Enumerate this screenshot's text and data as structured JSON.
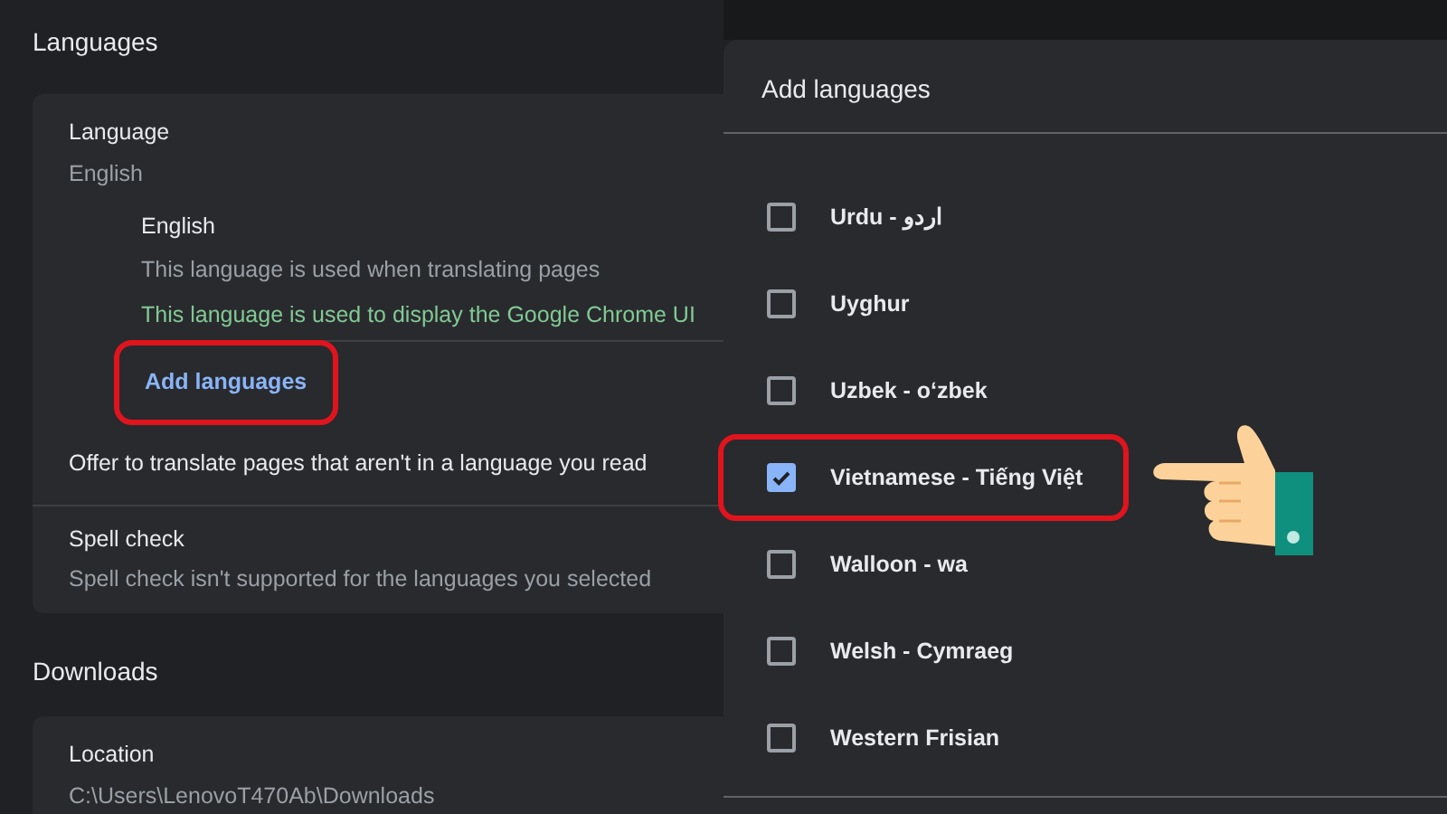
{
  "settings": {
    "languages_section": {
      "heading": "Languages",
      "language": {
        "label": "Language",
        "value": "English"
      },
      "language_item": {
        "name": "English",
        "notes": [
          {
            "kind": "plain",
            "text": "This language is used when translating pages"
          },
          {
            "kind": "ui",
            "text": "This language is used to display the Google Chrome UI"
          }
        ]
      },
      "add_button": {
        "label": "Add languages",
        "highlighted": true
      },
      "rows": [
        {
          "title": "Offer to translate pages that aren't in a language you read"
        },
        {
          "title": "Spell check",
          "subtitle": "Spell check isn't supported for the languages you selected"
        }
      ]
    },
    "downloads_section": {
      "heading": "Downloads",
      "location": {
        "label": "Location",
        "value": "C:\\Users\\LenovoT470Ab\\Downloads"
      }
    }
  },
  "dialog": {
    "title": "Add languages",
    "items": [
      {
        "label": "Urdu - اردو",
        "checked": false,
        "highlighted": false
      },
      {
        "label": "Uyghur",
        "checked": false,
        "highlighted": false
      },
      {
        "label": "Uzbek - o‘zbek",
        "checked": false,
        "highlighted": false
      },
      {
        "label": "Vietnamese - Tiếng Việt",
        "checked": true,
        "highlighted": true
      },
      {
        "label": "Walloon - wa",
        "checked": false,
        "highlighted": false
      },
      {
        "label": "Welsh - Cymraeg",
        "checked": false,
        "highlighted": false
      },
      {
        "label": "Western Frisian",
        "checked": false,
        "highlighted": false
      }
    ]
  }
}
